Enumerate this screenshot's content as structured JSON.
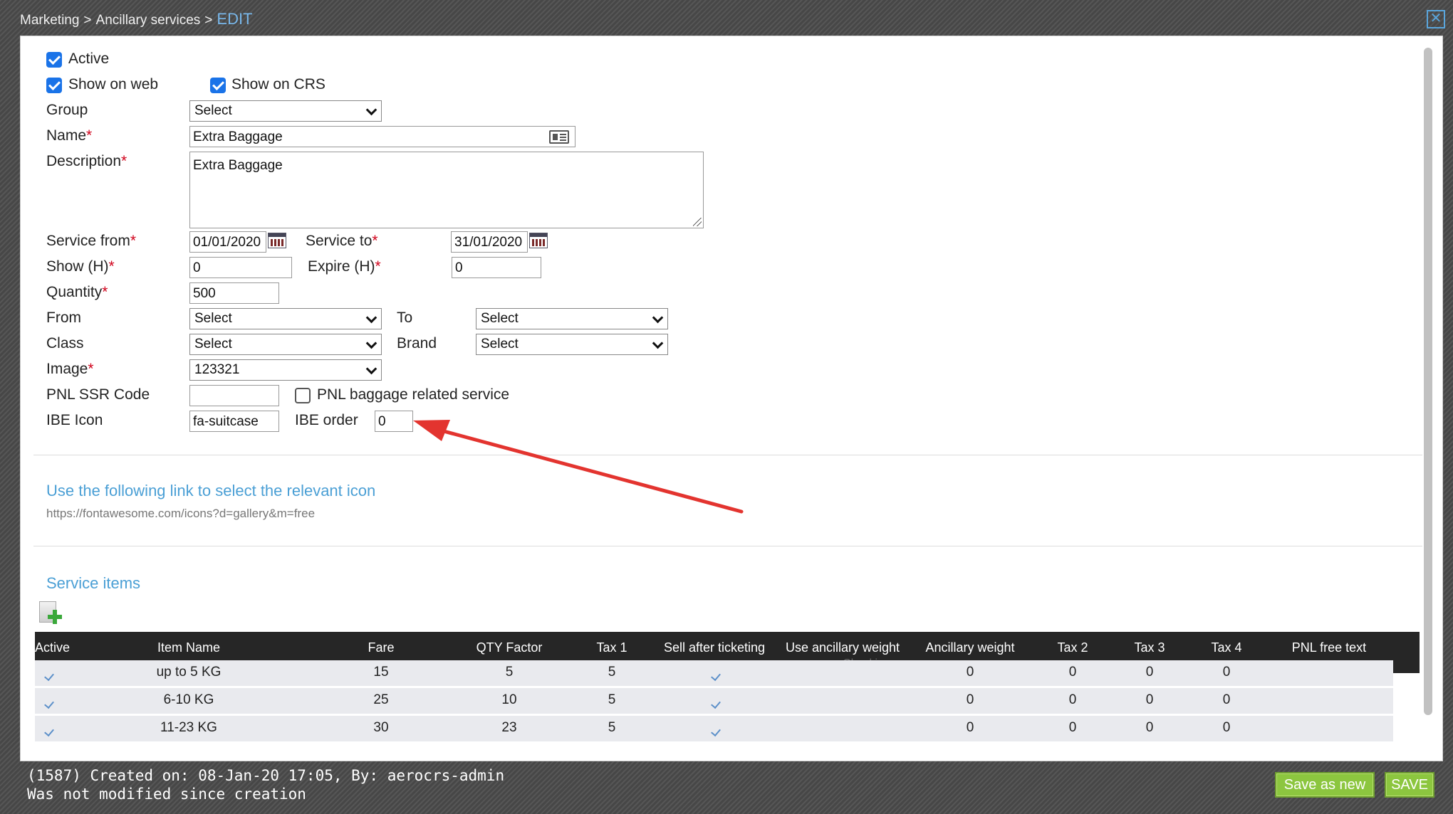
{
  "breadcrumb": [
    "Marketing",
    "Ancillary services",
    "EDIT"
  ],
  "breadcrumb_sep": ">",
  "close_glyph": "✕",
  "form": {
    "active": {
      "label": "Active",
      "checked": true
    },
    "show_on_web": {
      "label": "Show on web",
      "checked": true
    },
    "show_on_crs": {
      "label": "Show on CRS",
      "checked": true
    },
    "group": {
      "label": "Group",
      "value": "Select"
    },
    "name": {
      "label": "Name",
      "value": "Extra Baggage"
    },
    "description": {
      "label": "Description",
      "value": "Extra Baggage"
    },
    "service_from": {
      "label": "Service from",
      "value": "01/01/2020"
    },
    "service_to": {
      "label": "Service to",
      "value": "31/01/2020"
    },
    "show_h": {
      "label": "Show (H)",
      "value": "0"
    },
    "expire_h": {
      "label": "Expire (H)",
      "value": "0"
    },
    "quantity": {
      "label": "Quantity",
      "value": "500"
    },
    "from": {
      "label": "From",
      "value": "Select"
    },
    "to": {
      "label": "To",
      "value": "Select"
    },
    "class": {
      "label": "Class",
      "value": "Select"
    },
    "brand": {
      "label": "Brand",
      "value": "Select"
    },
    "image": {
      "label": "Image",
      "value": "123321"
    },
    "pnl_ssr_code": {
      "label": "PNL SSR Code",
      "value": ""
    },
    "pnl_baggage": {
      "label": "PNL baggage related service",
      "checked": false
    },
    "ibe_icon": {
      "label": "IBE Icon",
      "value": "fa-suitcase"
    },
    "ibe_order": {
      "label": "IBE order",
      "value": "0"
    },
    "required_mark": "*"
  },
  "icon_link": {
    "title": "Use the following link to select the relevant icon",
    "url": "https://fontawesome.com/icons?d=gallery&m=free"
  },
  "service_items": {
    "title": "Service items",
    "columns": [
      "Active",
      "Item Name",
      "Fare",
      "QTY Factor",
      "Tax 1",
      "Sell after ticketing",
      "Use ancillary weight",
      "Ancillary weight",
      "Tax 2",
      "Tax 3",
      "Tax 4",
      "PNL free text"
    ],
    "overflow_header_text": "Checkin",
    "rows": [
      {
        "active": true,
        "name": "up to 5 KG",
        "fare": "15",
        "qty": "5",
        "tax1": "5",
        "sell_after": true,
        "anc_weight": "0",
        "tax2": "0",
        "tax3": "0",
        "tax4": "0",
        "pnl": ""
      },
      {
        "active": true,
        "name": "6-10 KG",
        "fare": "25",
        "qty": "10",
        "tax1": "5",
        "sell_after": true,
        "anc_weight": "0",
        "tax2": "0",
        "tax3": "0",
        "tax4": "0",
        "pnl": ""
      },
      {
        "active": true,
        "name": "11-23 KG",
        "fare": "30",
        "qty": "23",
        "tax1": "5",
        "sell_after": true,
        "anc_weight": "0",
        "tax2": "0",
        "tax3": "0",
        "tax4": "0",
        "pnl": ""
      }
    ]
  },
  "footer": {
    "created": "(1587) Created on: 08-Jan-20 17:05, By: aerocrs-admin",
    "modified": "Was not modified since creation",
    "save_as_new": "Save as new",
    "save": "SAVE"
  },
  "colors": {
    "accent": "#1a73e8",
    "link": "#4a9fd5",
    "button": "#8cc63f",
    "required": "#d0021b",
    "annotation_arrow": "#e3342f"
  }
}
